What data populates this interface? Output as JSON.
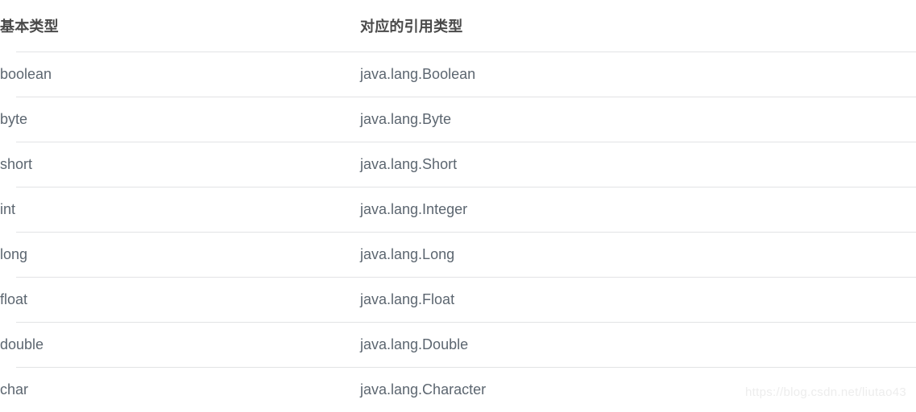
{
  "table": {
    "headers": {
      "primitive": "基本类型",
      "wrapper": "对应的引用类型"
    },
    "rows": [
      {
        "primitive": "boolean",
        "wrapper": "java.lang.Boolean"
      },
      {
        "primitive": "byte",
        "wrapper": "java.lang.Byte"
      },
      {
        "primitive": "short",
        "wrapper": "java.lang.Short"
      },
      {
        "primitive": "int",
        "wrapper": "java.lang.Integer"
      },
      {
        "primitive": "long",
        "wrapper": "java.lang.Long"
      },
      {
        "primitive": "float",
        "wrapper": "java.lang.Float"
      },
      {
        "primitive": "double",
        "wrapper": "java.lang.Double"
      },
      {
        "primitive": "char",
        "wrapper": "java.lang.Character"
      }
    ]
  },
  "watermark": {
    "text": "https://blog.csdn.net/liutao43"
  },
  "colors": {
    "background": "#ffffff",
    "header_text": "#4a4a4a",
    "body_text": "#5c6670",
    "row_divider": "#e2e3e5",
    "watermark_text": "#ededed"
  }
}
